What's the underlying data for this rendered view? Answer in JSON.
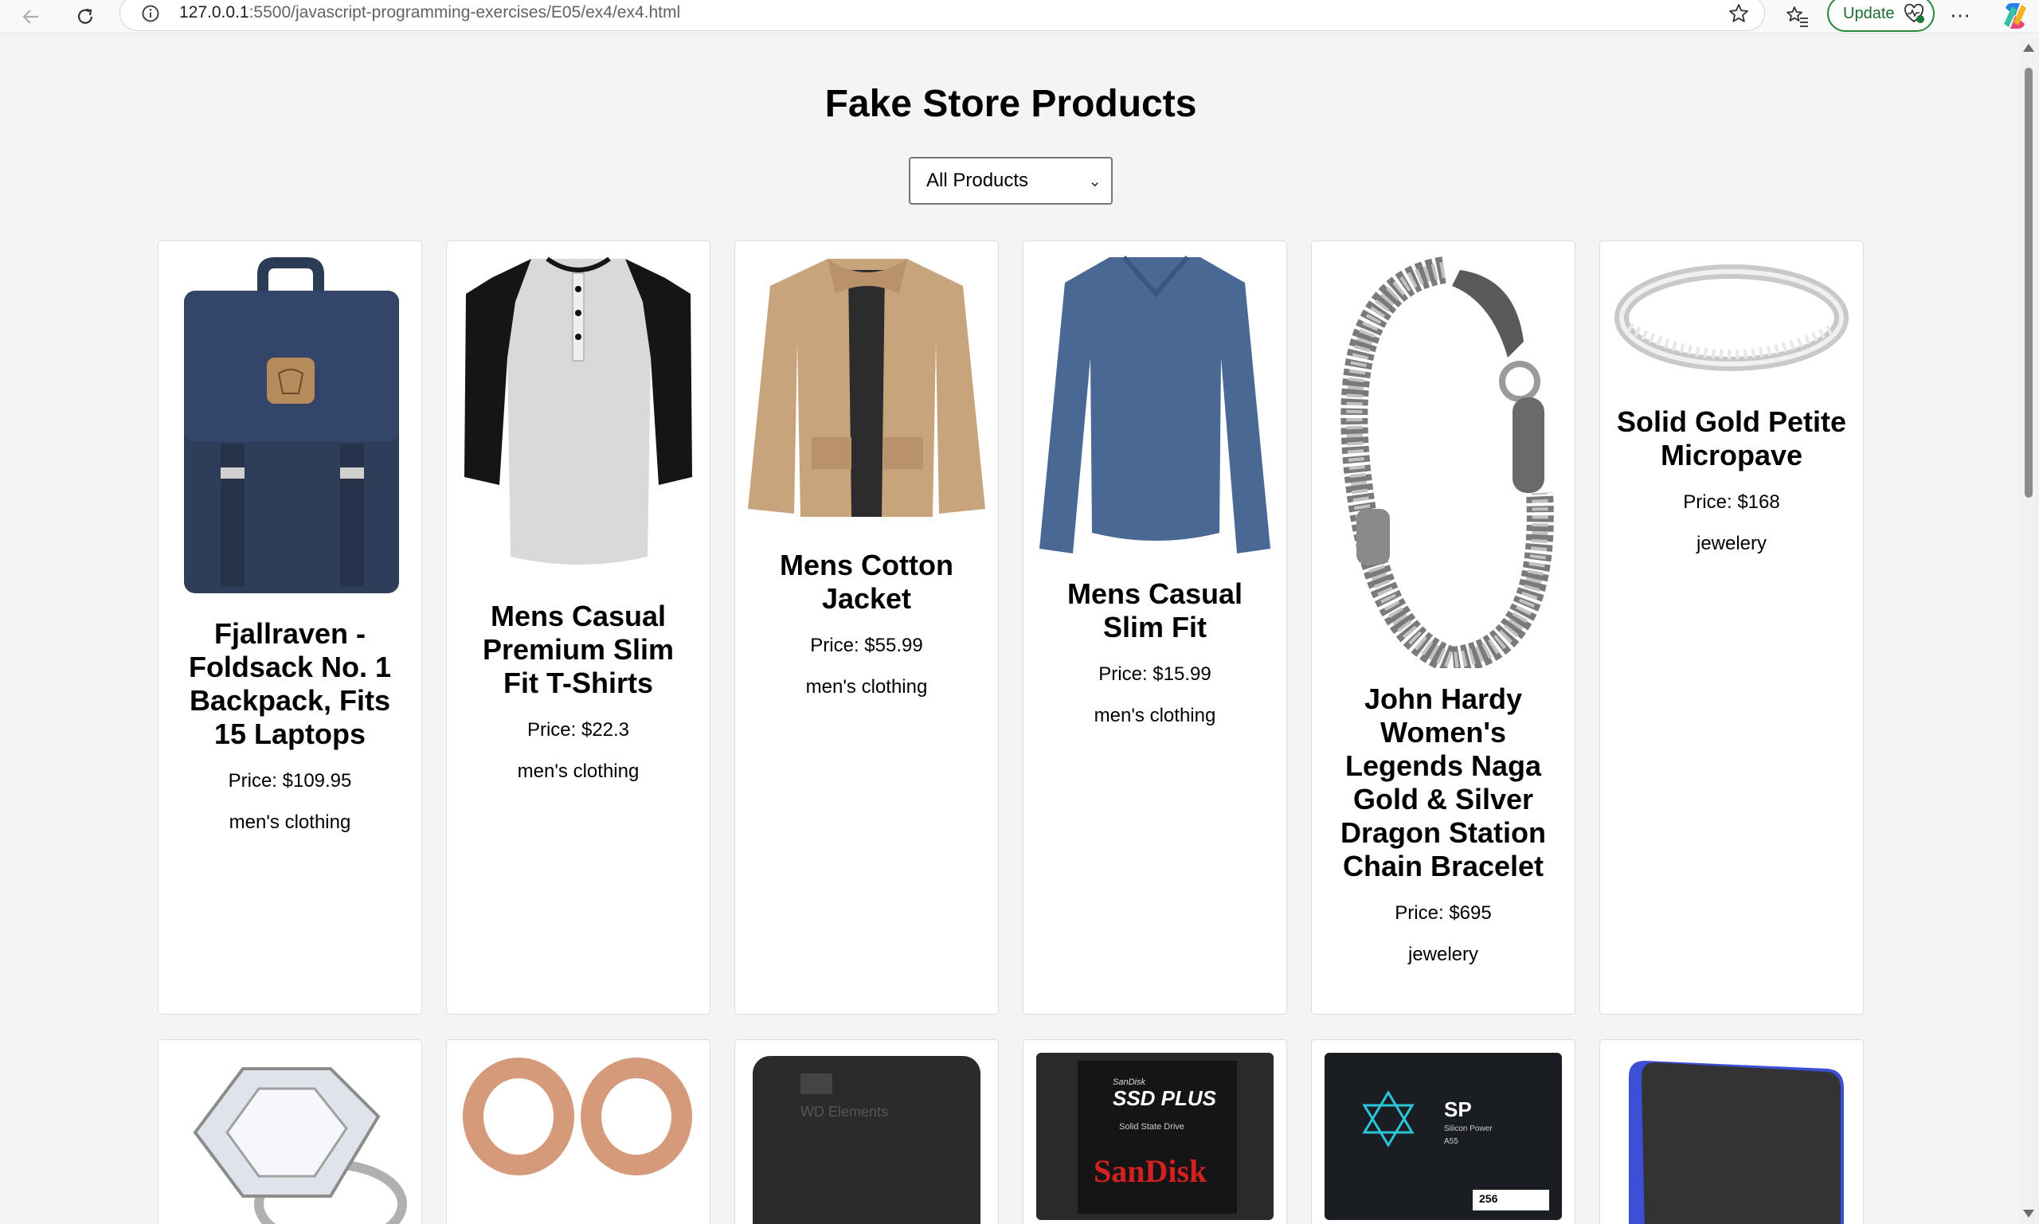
{
  "browser": {
    "url_host": "127.0.0.1",
    "url_rest": ":5500/javascript-programming-exercises/E05/ex4/ex4.html",
    "update_label": "Update"
  },
  "page": {
    "title": "Fake Store Products",
    "filter_selected": "All Products"
  },
  "products": [
    {
      "title": "Fjallraven - Foldsack No. 1 Backpack, Fits 15 Laptops",
      "price": "Price: $109.95",
      "category": "men's clothing"
    },
    {
      "title": "Mens Casual Premium Slim Fit T-Shirts",
      "price": "Price: $22.3",
      "category": "men's clothing"
    },
    {
      "title": "Mens Cotton Jacket",
      "price": "Price: $55.99",
      "category": "men's clothing"
    },
    {
      "title": "Mens Casual Slim Fit",
      "price": "Price: $15.99",
      "category": "men's clothing"
    },
    {
      "title": "John Hardy Women's Legends Naga Gold & Silver Dragon Station Chain Bracelet",
      "price": "Price: $695",
      "category": "jewelery"
    },
    {
      "title": "Solid Gold Petite Micropave",
      "price": "Price: $168",
      "category": "jewelery"
    }
  ],
  "product_images_row2": [
    {
      "icon": "diamond-ring-image"
    },
    {
      "icon": "rose-gold-tunnel-plugs-image"
    },
    {
      "icon": "wd-elements-hard-drive-image",
      "label": "WD Elements"
    },
    {
      "icon": "sandisk-ssd-image",
      "brand_top": "SanDisk",
      "model": "SSD PLUS",
      "sub": "Solid State Drive",
      "brand": "SanDisk"
    },
    {
      "icon": "silicon-power-ssd-image",
      "brand": "SP",
      "sub": "Silicon Power",
      "model": "A55",
      "capacity": "256"
    },
    {
      "icon": "external-drive-image"
    }
  ]
}
